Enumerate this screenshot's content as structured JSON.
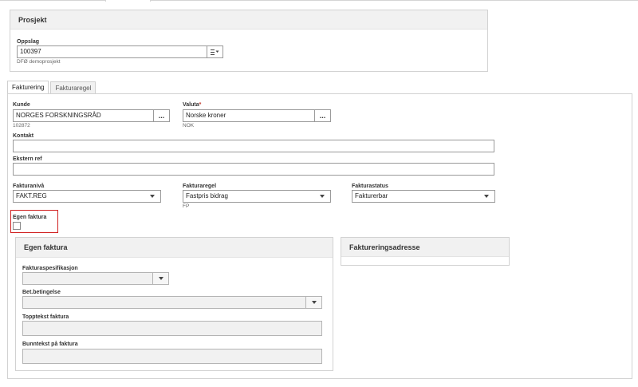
{
  "prosjekt": {
    "title": "Prosjekt",
    "oppslag_label": "Oppslag",
    "oppslag_value": "100397",
    "oppslag_sub": "DFØ demoprosjekt"
  },
  "tabs": [
    {
      "label": "Fakturering",
      "active": true
    },
    {
      "label": "Fakturaregel",
      "active": false
    }
  ],
  "fakturering": {
    "kunde_label": "Kunde",
    "kunde_value": "NORGES FORSKNINGSRÅD",
    "kunde_sub": "102872",
    "valuta_label": "Valuta",
    "valuta_required": "*",
    "valuta_value": "Norske kroner",
    "valuta_sub": "NOK",
    "kontakt_label": "Kontakt",
    "kontakt_value": "",
    "ekstern_ref_label": "Ekstern ref",
    "ekstern_ref_value": "",
    "fakturaniva_label": "Fakturanivå",
    "fakturaniva_value": "FAKT.REG",
    "fakturaregel_label": "Fakturaregel",
    "fakturaregel_value": "Fastpris bidrag",
    "fakturaregel_sub": "FP",
    "fakturastatus_label": "Fakturastatus",
    "fakturastatus_value": "Fakturerbar",
    "egen_faktura_label": "Egen faktura",
    "egen_faktura_checked": false
  },
  "egen_faktura_panel": {
    "title": "Egen faktura",
    "fakturaspesifikasjon_label": "Fakturaspesifikasjon",
    "fakturaspesifikasjon_value": "",
    "bet_betingelse_label": "Bet.betingelse",
    "bet_betingelse_value": "",
    "topptekst_label": "Topptekst faktura",
    "topptekst_value": "",
    "bunntekst_label": "Bunntekst på faktura",
    "bunntekst_value": ""
  },
  "faktureringsadresse_panel": {
    "title": "Faktureringsadresse"
  },
  "colors": {
    "highlight": "#d02020",
    "required": "#c0392b",
    "panel_header": "#f1f1f1"
  },
  "icons": {
    "lookup": "list-dropdown-icon",
    "more": "ellipsis-icon",
    "select": "chevron-down-icon"
  }
}
